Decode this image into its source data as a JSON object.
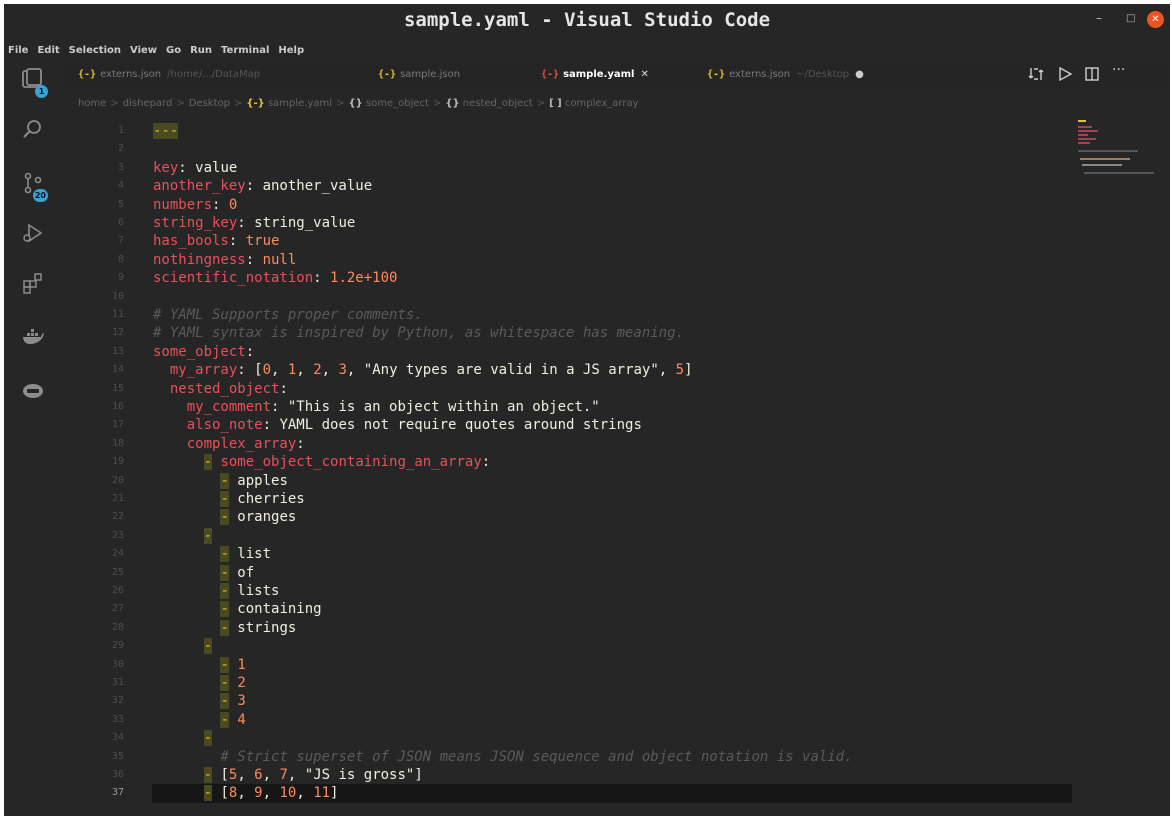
{
  "window": {
    "title": "sample.yaml - Visual Studio Code",
    "minimize": "–",
    "maximize": "□",
    "close": "✕"
  },
  "menu": [
    "File",
    "Edit",
    "Selection",
    "View",
    "Go",
    "Run",
    "Terminal",
    "Help"
  ],
  "activity_bar": {
    "remote_badge": "1",
    "scm_badge": "20"
  },
  "tabs": [
    {
      "icon": "{-}",
      "label": "externs.json",
      "description": "/home/.../DataMap",
      "active": false
    },
    {
      "icon": "{-}",
      "label": "sample.json",
      "description": "",
      "active": false
    },
    {
      "icon": "{-}",
      "label": "sample.yaml",
      "description": "",
      "active": true,
      "close": "✕"
    },
    {
      "icon": "{-}",
      "label": "externs.json",
      "description": "~/Desktop",
      "active": false,
      "modified": "●"
    }
  ],
  "breadcrumb": {
    "items": [
      "home",
      "dishepard",
      "Desktop"
    ],
    "file_icon": "{-}",
    "file": "sample.yaml",
    "obj_icon": "{}",
    "some_object": "some_object",
    "nested_object": "nested_object",
    "arr_icon": "[ ]",
    "complex_array": "complex_array",
    "separator": ">"
  },
  "editor": {
    "current_line": 37,
    "lines": [
      {
        "n": "1",
        "tokens": [
          {
            "t": "---",
            "c": "d"
          }
        ]
      },
      {
        "n": "2",
        "tokens": []
      },
      {
        "n": "3",
        "tokens": [
          {
            "t": "key",
            "c": "k"
          },
          {
            "t": ": ",
            "c": "p"
          },
          {
            "t": "value",
            "c": "v"
          }
        ]
      },
      {
        "n": "4",
        "tokens": [
          {
            "t": "another_key",
            "c": "k"
          },
          {
            "t": ": ",
            "c": "p"
          },
          {
            "t": "another_value",
            "c": "v"
          }
        ]
      },
      {
        "n": "5",
        "tokens": [
          {
            "t": "numbers",
            "c": "k"
          },
          {
            "t": ": ",
            "c": "p"
          },
          {
            "t": "0",
            "c": "n"
          }
        ]
      },
      {
        "n": "6",
        "tokens": [
          {
            "t": "string_key",
            "c": "k"
          },
          {
            "t": ": ",
            "c": "p"
          },
          {
            "t": "string_value",
            "c": "v"
          }
        ]
      },
      {
        "n": "7",
        "tokens": [
          {
            "t": "has_bools",
            "c": "k"
          },
          {
            "t": ": ",
            "c": "p"
          },
          {
            "t": "true",
            "c": "n"
          }
        ]
      },
      {
        "n": "8",
        "tokens": [
          {
            "t": "nothingness",
            "c": "k"
          },
          {
            "t": ": ",
            "c": "p"
          },
          {
            "t": "null",
            "c": "n"
          }
        ]
      },
      {
        "n": "9",
        "tokens": [
          {
            "t": "scientific_notation",
            "c": "k"
          },
          {
            "t": ": ",
            "c": "p"
          },
          {
            "t": "1.2e+100",
            "c": "n"
          }
        ]
      },
      {
        "n": "10",
        "tokens": []
      },
      {
        "n": "11",
        "tokens": [
          {
            "t": "# YAML Supports proper comments.",
            "c": "c"
          }
        ]
      },
      {
        "n": "12",
        "tokens": [
          {
            "t": "# YAML syntax is inspired by Python, as whitespace has meaning.",
            "c": "c"
          }
        ]
      },
      {
        "n": "13",
        "tokens": [
          {
            "t": "some_object",
            "c": "k"
          },
          {
            "t": ":",
            "c": "p"
          }
        ]
      },
      {
        "n": "14",
        "tokens": [
          {
            "t": "  ",
            "c": "p"
          },
          {
            "t": "my_array",
            "c": "k"
          },
          {
            "t": ": [",
            "c": "p"
          },
          {
            "t": "0",
            "c": "n"
          },
          {
            "t": ", ",
            "c": "p"
          },
          {
            "t": "1",
            "c": "n"
          },
          {
            "t": ", ",
            "c": "p"
          },
          {
            "t": "2",
            "c": "n"
          },
          {
            "t": ", ",
            "c": "p"
          },
          {
            "t": "3",
            "c": "n"
          },
          {
            "t": ", ",
            "c": "p"
          },
          {
            "t": "\"Any types are valid in a JS array\"",
            "c": "v"
          },
          {
            "t": ", ",
            "c": "p"
          },
          {
            "t": "5",
            "c": "n"
          },
          {
            "t": "]",
            "c": "p"
          }
        ]
      },
      {
        "n": "15",
        "tokens": [
          {
            "t": "  ",
            "c": "p"
          },
          {
            "t": "nested_object",
            "c": "k"
          },
          {
            "t": ":",
            "c": "p"
          }
        ]
      },
      {
        "n": "16",
        "tokens": [
          {
            "t": "    ",
            "c": "p"
          },
          {
            "t": "my_comment",
            "c": "k"
          },
          {
            "t": ": ",
            "c": "p"
          },
          {
            "t": "\"This is an object within an object.\"",
            "c": "v"
          }
        ]
      },
      {
        "n": "17",
        "tokens": [
          {
            "t": "    ",
            "c": "p"
          },
          {
            "t": "also_note",
            "c": "k"
          },
          {
            "t": ": ",
            "c": "p"
          },
          {
            "t": "YAML does not require quotes around strings",
            "c": "v"
          }
        ]
      },
      {
        "n": "18",
        "tokens": [
          {
            "t": "    ",
            "c": "p"
          },
          {
            "t": "complex_array",
            "c": "k"
          },
          {
            "t": ":",
            "c": "p"
          }
        ]
      },
      {
        "n": "19",
        "tokens": [
          {
            "t": "      ",
            "c": "p"
          },
          {
            "t": "-",
            "c": "d"
          },
          {
            "t": " ",
            "c": "p"
          },
          {
            "t": "some_object_containing_an_array",
            "c": "k"
          },
          {
            "t": ":",
            "c": "p"
          }
        ]
      },
      {
        "n": "20",
        "tokens": [
          {
            "t": "        ",
            "c": "p"
          },
          {
            "t": "-",
            "c": "d"
          },
          {
            "t": " apples",
            "c": "v"
          }
        ]
      },
      {
        "n": "21",
        "tokens": [
          {
            "t": "        ",
            "c": "p"
          },
          {
            "t": "-",
            "c": "d"
          },
          {
            "t": " cherries",
            "c": "v"
          }
        ]
      },
      {
        "n": "22",
        "tokens": [
          {
            "t": "        ",
            "c": "p"
          },
          {
            "t": "-",
            "c": "d"
          },
          {
            "t": " oranges",
            "c": "v"
          }
        ]
      },
      {
        "n": "23",
        "tokens": [
          {
            "t": "      ",
            "c": "p"
          },
          {
            "t": "-",
            "c": "d"
          }
        ]
      },
      {
        "n": "24",
        "tokens": [
          {
            "t": "        ",
            "c": "p"
          },
          {
            "t": "-",
            "c": "d"
          },
          {
            "t": " list",
            "c": "v"
          }
        ]
      },
      {
        "n": "25",
        "tokens": [
          {
            "t": "        ",
            "c": "p"
          },
          {
            "t": "-",
            "c": "d"
          },
          {
            "t": " of",
            "c": "v"
          }
        ]
      },
      {
        "n": "26",
        "tokens": [
          {
            "t": "        ",
            "c": "p"
          },
          {
            "t": "-",
            "c": "d"
          },
          {
            "t": " lists",
            "c": "v"
          }
        ]
      },
      {
        "n": "27",
        "tokens": [
          {
            "t": "        ",
            "c": "p"
          },
          {
            "t": "-",
            "c": "d"
          },
          {
            "t": " containing",
            "c": "v"
          }
        ]
      },
      {
        "n": "28",
        "tokens": [
          {
            "t": "        ",
            "c": "p"
          },
          {
            "t": "-",
            "c": "d"
          },
          {
            "t": " strings",
            "c": "v"
          }
        ]
      },
      {
        "n": "29",
        "tokens": [
          {
            "t": "      ",
            "c": "p"
          },
          {
            "t": "-",
            "c": "d"
          }
        ]
      },
      {
        "n": "30",
        "tokens": [
          {
            "t": "        ",
            "c": "p"
          },
          {
            "t": "-",
            "c": "d"
          },
          {
            "t": " ",
            "c": "p"
          },
          {
            "t": "1",
            "c": "n"
          }
        ]
      },
      {
        "n": "31",
        "tokens": [
          {
            "t": "        ",
            "c": "p"
          },
          {
            "t": "-",
            "c": "d"
          },
          {
            "t": " ",
            "c": "p"
          },
          {
            "t": "2",
            "c": "n"
          }
        ]
      },
      {
        "n": "32",
        "tokens": [
          {
            "t": "        ",
            "c": "p"
          },
          {
            "t": "-",
            "c": "d"
          },
          {
            "t": " ",
            "c": "p"
          },
          {
            "t": "3",
            "c": "n"
          }
        ]
      },
      {
        "n": "33",
        "tokens": [
          {
            "t": "        ",
            "c": "p"
          },
          {
            "t": "-",
            "c": "d"
          },
          {
            "t": " ",
            "c": "p"
          },
          {
            "t": "4",
            "c": "n"
          }
        ]
      },
      {
        "n": "34",
        "tokens": [
          {
            "t": "      ",
            "c": "p"
          },
          {
            "t": "-",
            "c": "d"
          }
        ]
      },
      {
        "n": "35",
        "tokens": [
          {
            "t": "        ",
            "c": "p"
          },
          {
            "t": "# Strict superset of JSON means JSON sequence and object notation is valid.",
            "c": "c"
          }
        ]
      },
      {
        "n": "36",
        "tokens": [
          {
            "t": "      ",
            "c": "p"
          },
          {
            "t": "-",
            "c": "d"
          },
          {
            "t": " [",
            "c": "p"
          },
          {
            "t": "5",
            "c": "n"
          },
          {
            "t": ", ",
            "c": "p"
          },
          {
            "t": "6",
            "c": "n"
          },
          {
            "t": ", ",
            "c": "p"
          },
          {
            "t": "7",
            "c": "n"
          },
          {
            "t": ", ",
            "c": "p"
          },
          {
            "t": "\"JS is gross\"",
            "c": "v"
          },
          {
            "t": "]",
            "c": "p"
          }
        ]
      },
      {
        "n": "37",
        "tokens": [
          {
            "t": "      ",
            "c": "p"
          },
          {
            "t": "-",
            "c": "d"
          },
          {
            "t": " [",
            "c": "p"
          },
          {
            "t": "8",
            "c": "n"
          },
          {
            "t": ", ",
            "c": "p"
          },
          {
            "t": "9",
            "c": "n"
          },
          {
            "t": ", ",
            "c": "p"
          },
          {
            "t": "10",
            "c": "n"
          },
          {
            "t": ", ",
            "c": "p"
          },
          {
            "t": "11",
            "c": "n"
          },
          {
            "t": "]",
            "c": "p"
          }
        ]
      }
    ]
  },
  "icons": {
    "activity": [
      "remote-explorer-icon",
      "search-icon",
      "source-control-icon",
      "run-debug-icon",
      "extensions-icon",
      "docker-icon",
      "remote-containers-icon"
    ],
    "editor_actions": [
      "compare-changes-icon",
      "run-icon",
      "split-editor-icon",
      "more-actions-icon"
    ]
  },
  "colors": {
    "key": "#e8505b",
    "value": "#f0eee0",
    "number": "#ff8a5c",
    "comment": "#5a5a5a",
    "dash_marker": "#e6c229",
    "background": "#262626",
    "badge": "#37a3d9",
    "close_button": "#e95420"
  }
}
